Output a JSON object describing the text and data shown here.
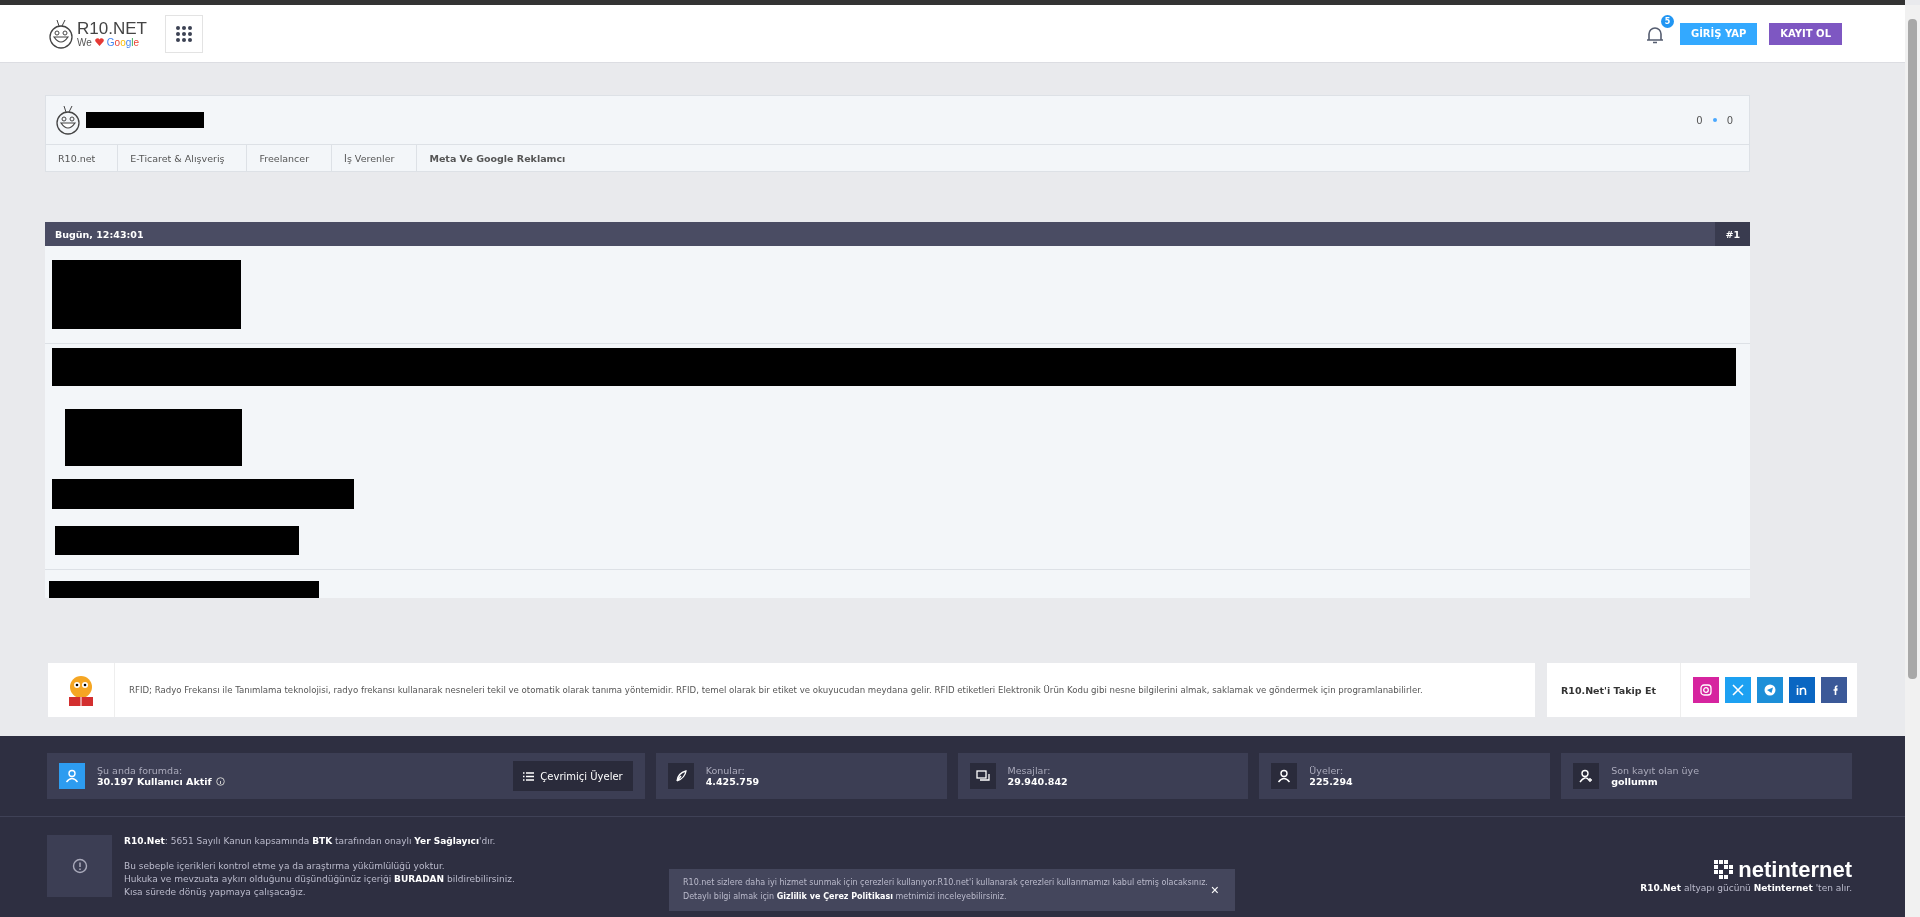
{
  "header": {
    "logo": {
      "name": "R10.NET",
      "tagline_we": "We",
      "tagline_google": "Google"
    },
    "notifications": {
      "count": "5"
    },
    "buttons": [
      {
        "label": "GİRİŞ YAP",
        "kind": "login"
      },
      {
        "label": "KAYIT OL",
        "kind": "register"
      }
    ]
  },
  "thread": {
    "stats": [
      "0",
      "0"
    ],
    "breadcrumb": [
      {
        "label": "R10.net",
        "current": false
      },
      {
        "label": "E-Ticaret & Alışveriş",
        "current": false
      },
      {
        "label": "Freelancer",
        "current": false
      },
      {
        "label": "İş Verenler",
        "current": false
      },
      {
        "label": "Meta Ve Google Reklamcı",
        "current": true
      }
    ]
  },
  "post": {
    "date": "Bugün, 12:43:01",
    "number": "#1"
  },
  "info": {
    "text": "RFID; Radyo Frekansı ile Tanımlama teknolojisi, radyo frekansı kullanarak nesneleri tekil ve otomatik olarak tanıma yöntemidir. RFID, temel olarak bir etiket ve okuyucudan meydana gelir. RFID etiketleri Elektronik Ürün Kodu gibi nesne bilgilerini almak, saklamak ve göndermek için programlanabilirler.",
    "follow_label": "R10.Net'i Takip Et",
    "social": [
      {
        "kind": "instagram",
        "color": "#d6249f"
      },
      {
        "kind": "x",
        "color": "#1da1f2"
      },
      {
        "kind": "telegram",
        "color": "#1d8fd8"
      },
      {
        "kind": "linkedin",
        "color": "#0a66c2"
      },
      {
        "kind": "facebook",
        "color": "#3b5998"
      }
    ]
  },
  "stats": {
    "online": {
      "label": "Şu anda forumda:",
      "value": "30.197 Kullanıcı Aktif",
      "button": "Çevrimiçi Üyeler"
    },
    "items": [
      {
        "kind": "topics",
        "label": "Konular:",
        "value": "4.425.759"
      },
      {
        "kind": "messages",
        "label": "Mesajlar:",
        "value": "29.940.842"
      },
      {
        "kind": "members",
        "label": "Üyeler:",
        "value": "225.294"
      },
      {
        "kind": "latest",
        "label": "Son kayıt olan üye",
        "value": "gollumm"
      }
    ]
  },
  "footer": {
    "legal": [
      "**R10.Net**: 5651 Sayılı Kanun kapsamında **BTK** tarafından onaylı **Yer Sağlayıcı**'dır.",
      "Bu sebeple içerikleri kontrol etme ya da araştırma yükümlülüğü yoktur.",
      "Hukuka ve mevzuata aykırı olduğunu düşündüğünüz içeriği **BURADAN** bildirebilirsiniz.",
      "Kısa sürede dönüş yapmaya çalışacağız."
    ],
    "cookie": {
      "line1": "R10.net sizlere daha iyi hizmet sunmak için çerezleri kullanıyor.R10.net'i kullanarak çerezleri kullanmamızı kabul etmiş olacaksınız.",
      "line2": "Detaylı bilgi almak için **Gizlilik ve Çerez Politikası** metnimizi inceleyebilirsiniz.",
      "close": "×"
    },
    "partner": {
      "name": "netinternet",
      "text": "**R10.Net** altyapı gücünü **Netinternet** 'ten alır."
    }
  }
}
